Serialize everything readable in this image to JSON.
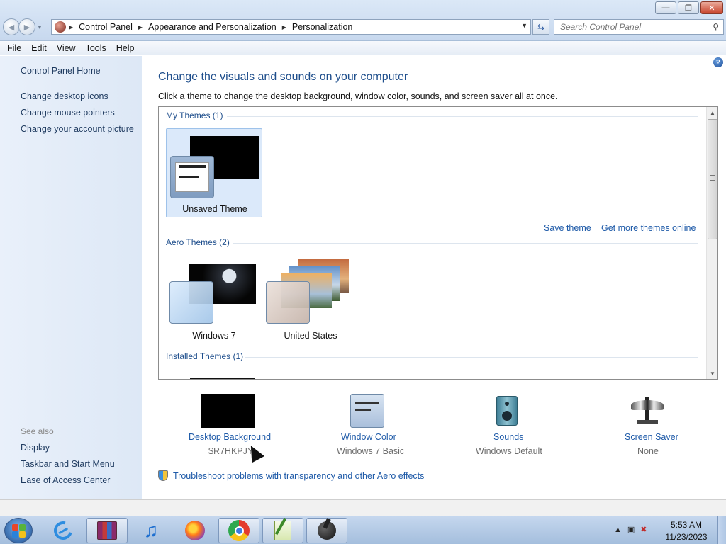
{
  "window": {
    "minimize_label": "—",
    "restore_label": "❐",
    "close_label": "✕"
  },
  "address": {
    "crumbs": [
      "Control Panel",
      "Appearance and Personalization",
      "Personalization"
    ],
    "search_placeholder": "Search Control Panel"
  },
  "menu": [
    "File",
    "Edit",
    "View",
    "Tools",
    "Help"
  ],
  "sidebar": {
    "home": "Control Panel Home",
    "links": [
      "Change desktop icons",
      "Change mouse pointers",
      "Change your account picture"
    ],
    "see_also_label": "See also",
    "see_also": [
      "Display",
      "Taskbar and Start Menu",
      "Ease of Access Center"
    ]
  },
  "main": {
    "title": "Change the visuals and sounds on your computer",
    "subtitle": "Click a theme to change the desktop background, window color, sounds, and screen saver all at once.",
    "groups": [
      {
        "label": "My Themes (1)",
        "themes": [
          "Unsaved Theme"
        ]
      },
      {
        "label": "Aero Themes (2)",
        "themes": [
          "Windows 7",
          "United States"
        ]
      },
      {
        "label": "Installed Themes (1)",
        "themes": []
      }
    ],
    "save_theme": "Save theme",
    "get_more": "Get more themes online"
  },
  "settings": [
    {
      "title": "Desktop Background",
      "value": "$R7HKPJY"
    },
    {
      "title": "Window Color",
      "value": "Windows 7 Basic"
    },
    {
      "title": "Sounds",
      "value": "Windows Default"
    },
    {
      "title": "Screen Saver",
      "value": "None"
    }
  ],
  "troubleshoot": "Troubleshoot problems with transparency and other Aero effects",
  "clock": {
    "time": "5:53 AM",
    "date": "11/23/2023"
  },
  "colors": {
    "link": "#1e5aa8",
    "heading": "#1e4e8c",
    "selection": "#dbe9fa"
  }
}
